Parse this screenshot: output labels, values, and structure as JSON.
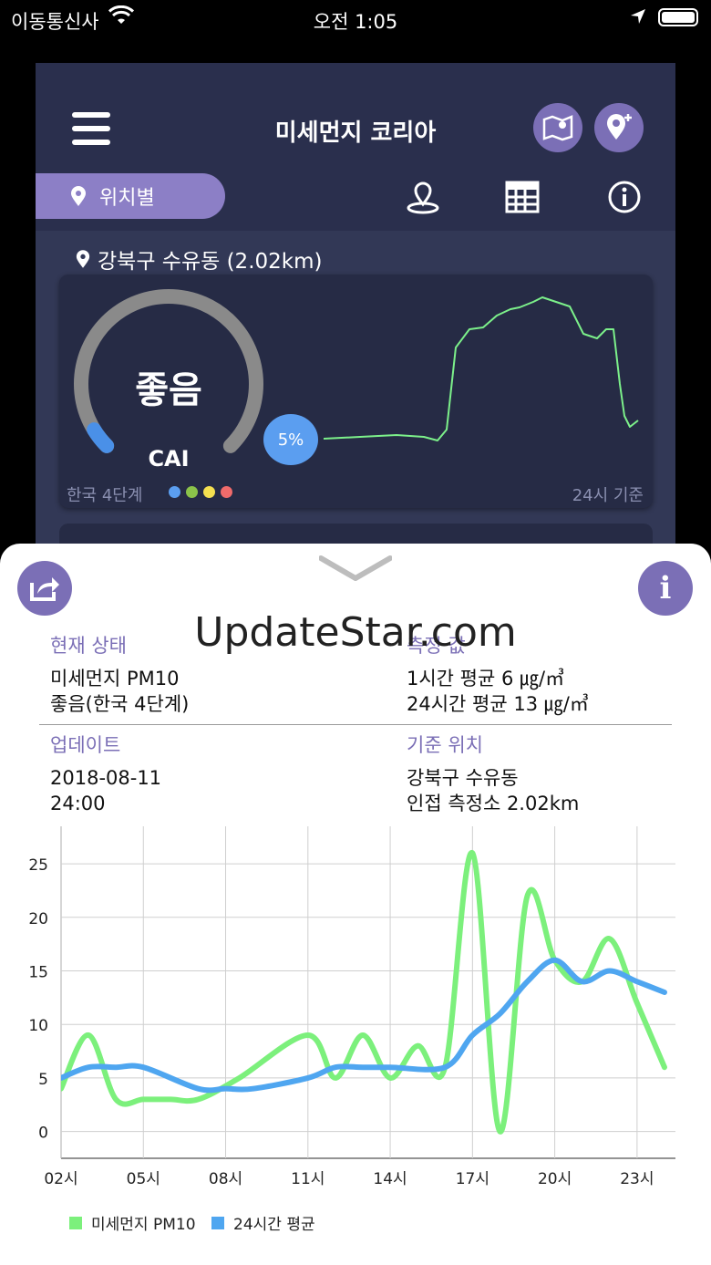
{
  "status_bar": {
    "carrier": "이동통신사",
    "time": "오전 1:05"
  },
  "header": {
    "title": "미세먼지 코리아"
  },
  "tabs": {
    "location_tab": "위치별"
  },
  "location": {
    "label": "강북구 수유동 (2.02km)"
  },
  "card": {
    "grade": "좋음",
    "index_name": "CAI",
    "percent": "5%",
    "percent_value": 5,
    "scale_label": "한국 4단계",
    "scale_colors": [
      "#5b9ef0",
      "#8bc34a",
      "#f5e050",
      "#f06b6b"
    ],
    "basis": "24시 기준",
    "line_color": "#7cf08a"
  },
  "watermark": "UpdateStar.com",
  "details": {
    "status": {
      "label": "현재 상태",
      "line1": "미세먼지 PM10",
      "line2": "좋음(한국 4단계)"
    },
    "measure": {
      "label": "측정 값",
      "line1": "1시간 평균 6 ㎍/㎥",
      "line2": "24시간 평균 13 ㎍/㎥"
    },
    "update": {
      "label": "업데이트",
      "line1": "2018-08-11",
      "line2": "24:00"
    },
    "station": {
      "label": "기준 위치",
      "line1": "강북구 수유동",
      "line2": "인접 측정소 2.02km"
    }
  },
  "chart_data": {
    "type": "line",
    "title": "",
    "xlabel": "",
    "ylabel": "",
    "ylim": [
      -2.5,
      28.5
    ],
    "yticks": [
      "0",
      "5",
      "10",
      "15",
      "20",
      "25"
    ],
    "xtick_labels": [
      "02시",
      "05시",
      "08시",
      "11시",
      "14시",
      "17시",
      "20시",
      "23시"
    ],
    "x": [
      2,
      3,
      4,
      5,
      6,
      7,
      8,
      9,
      10,
      11,
      12,
      13,
      14,
      15,
      16,
      17,
      18,
      19,
      20,
      21,
      22,
      23,
      24
    ],
    "grid": true,
    "legend_placement": "bottom-left",
    "series": [
      {
        "name": "미세먼지 PM10",
        "color": "#7cf07c",
        "values": [
          4,
          9,
          3,
          3,
          3,
          3,
          5,
          9,
          5,
          9,
          5,
          8,
          6,
          26,
          0,
          22,
          16,
          14,
          18,
          12,
          6
        ],
        "x": [
          2,
          3,
          4,
          5,
          6,
          7,
          8.5,
          11,
          12,
          13,
          14,
          15,
          16,
          17,
          18,
          19,
          20,
          21,
          22,
          23,
          24
        ]
      },
      {
        "name": "24시간 평균",
        "color": "#4fa6f0",
        "values": [
          5,
          6,
          6,
          6,
          4,
          4,
          4,
          5,
          6,
          6,
          6,
          6,
          9,
          11,
          14,
          16,
          14,
          15,
          14,
          13
        ],
        "x": [
          2,
          3,
          4,
          5,
          7,
          8,
          9,
          11,
          12,
          13,
          14,
          16,
          17,
          18,
          19,
          20,
          21,
          22,
          23,
          24
        ]
      }
    ]
  },
  "legend": {
    "pm10": "미세먼지 PM10",
    "avg24": "24시간 평균"
  }
}
